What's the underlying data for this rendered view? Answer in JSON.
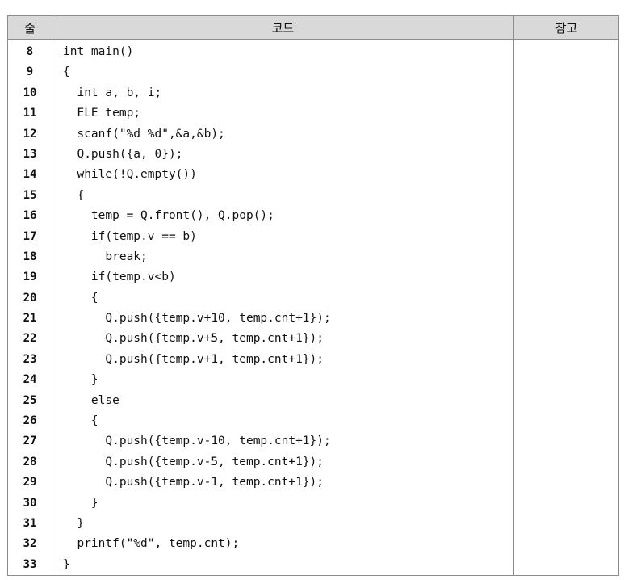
{
  "table": {
    "headers": {
      "line": "줄",
      "code": "코드",
      "note": "참고"
    },
    "line_numbers": [
      "8",
      "9",
      "10",
      "11",
      "12",
      "13",
      "14",
      "15",
      "16",
      "17",
      "18",
      "19",
      "20",
      "21",
      "22",
      "23",
      "24",
      "25",
      "26",
      "27",
      "28",
      "29",
      "30",
      "31",
      "32",
      "33"
    ],
    "code_lines": [
      "int main()",
      "{",
      "  int a, b, i;",
      "  ELE temp;",
      "  scanf(\"%d %d\",&a,&b);",
      "  Q.push({a, 0});",
      "  while(!Q.empty())",
      "  {",
      "    temp = Q.front(), Q.pop();",
      "    if(temp.v == b)",
      "      break;",
      "    if(temp.v<b)",
      "    {",
      "      Q.push({temp.v+10, temp.cnt+1});",
      "      Q.push({temp.v+5, temp.cnt+1});",
      "      Q.push({temp.v+1, temp.cnt+1});",
      "    }",
      "    else",
      "    {",
      "      Q.push({temp.v-10, temp.cnt+1});",
      "      Q.push({temp.v-5, temp.cnt+1});",
      "      Q.push({temp.v-1, temp.cnt+1});",
      "    }",
      "  }",
      "  printf(\"%d\", temp.cnt);",
      "}"
    ],
    "note": ""
  }
}
